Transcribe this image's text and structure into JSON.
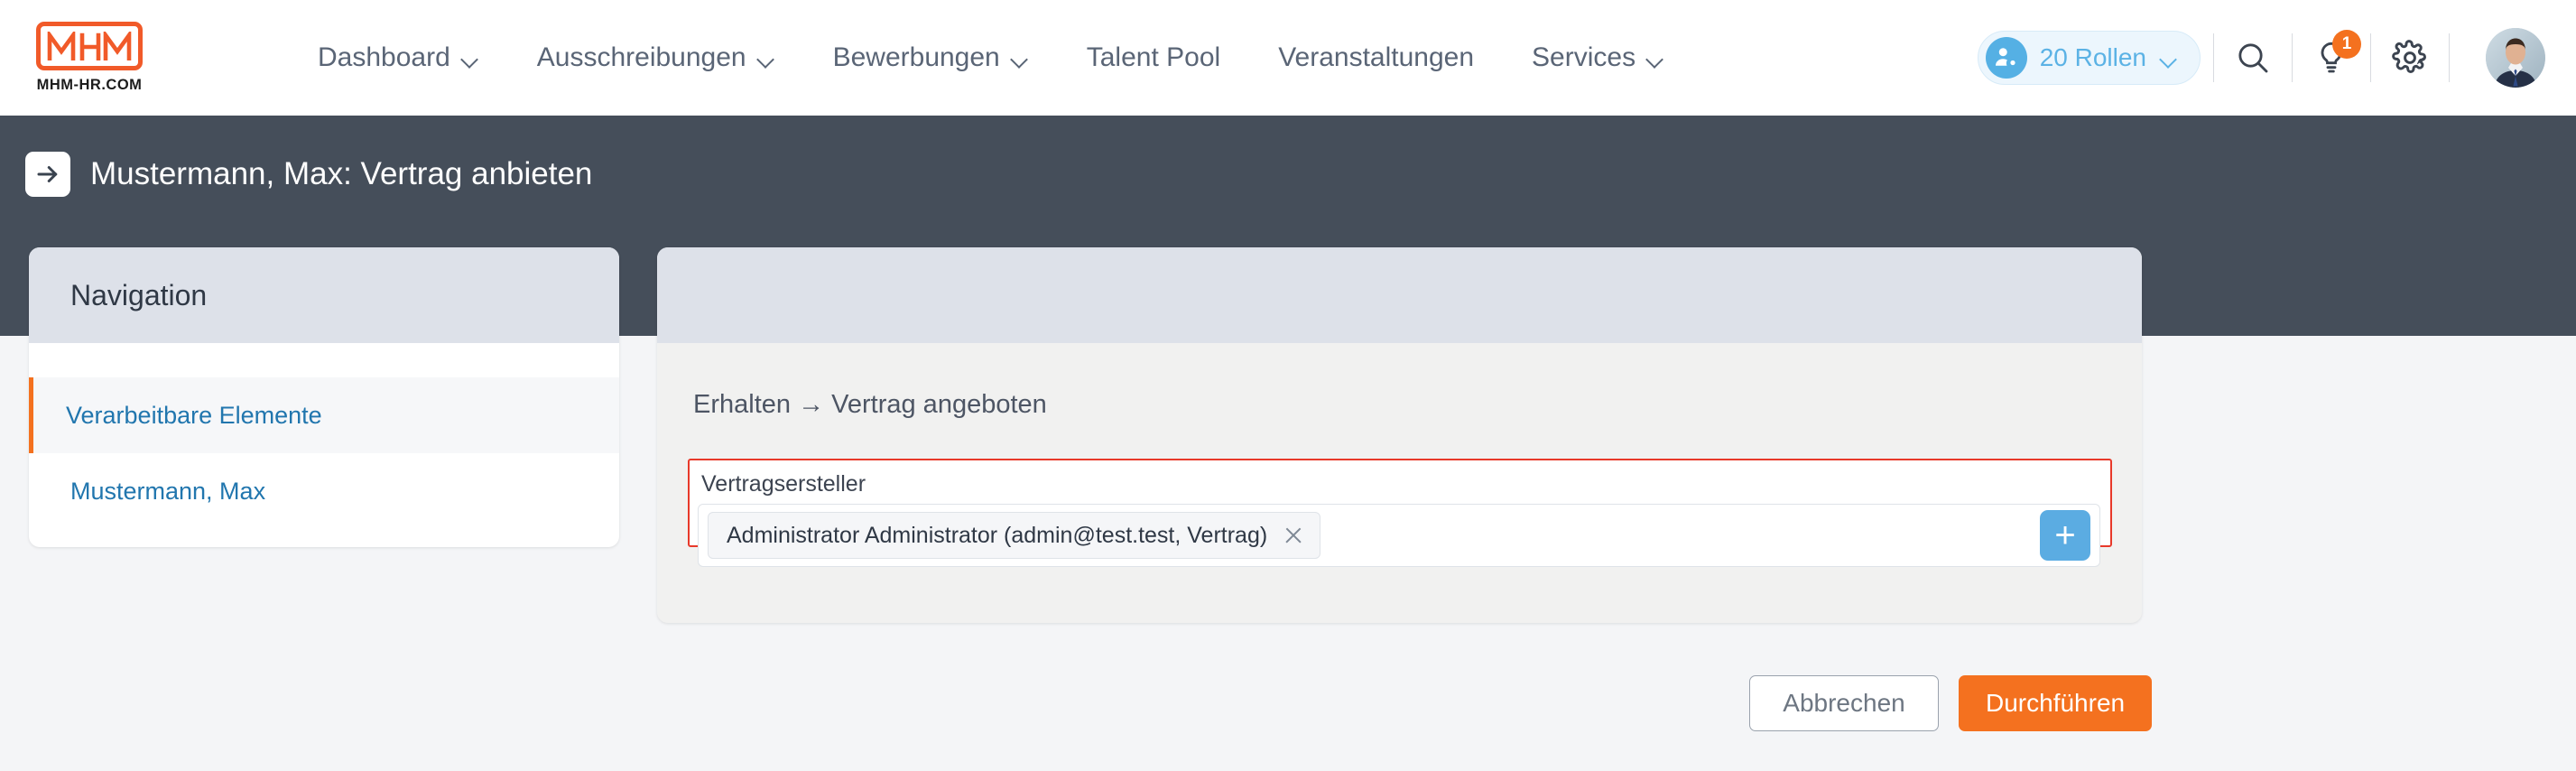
{
  "brand": {
    "logo_text": "MHM",
    "logo_subtitle": "MHM-HR.COM",
    "accent_orange": "#F4711F",
    "dark_slate": "#454E5A",
    "link_blue": "#2176AE",
    "error_red": "#E8392A",
    "action_blue": "#5BACE2"
  },
  "header": {
    "nav": [
      {
        "label": "Dashboard",
        "has_dropdown": true
      },
      {
        "label": "Ausschreibungen",
        "has_dropdown": true
      },
      {
        "label": "Bewerbungen",
        "has_dropdown": true
      },
      {
        "label": "Talent Pool",
        "has_dropdown": false
      },
      {
        "label": "Veranstaltungen",
        "has_dropdown": false
      },
      {
        "label": "Services",
        "has_dropdown": true
      }
    ],
    "roles_pill": {
      "label": "20 Rollen",
      "icon": "user-gear-icon"
    },
    "icons": {
      "search": "search-icon",
      "tips": "lightbulb-icon",
      "settings": "gear-icon",
      "avatar": "user-avatar"
    },
    "notification_count": "1"
  },
  "page": {
    "title": "Mustermann, Max: Vertrag anbieten",
    "title_icon": "arrow-right-icon"
  },
  "navigation_panel": {
    "heading": "Navigation",
    "items": [
      {
        "label": "Verarbeitbare Elemente",
        "active": true
      },
      {
        "label": "Mustermann, Max",
        "active": false
      }
    ]
  },
  "main_panel": {
    "step_transition": "Erhalten → Vertrag angeboten",
    "field": {
      "label": "Vertragsersteller",
      "has_error": true,
      "chips": [
        {
          "text": "Administrator Administrator (admin@test.test, Vertrag)",
          "remove_icon": "close-icon"
        }
      ],
      "add_button_icon": "plus-icon"
    }
  },
  "footer": {
    "cancel_label": "Abbrechen",
    "submit_label": "Durchführen"
  }
}
